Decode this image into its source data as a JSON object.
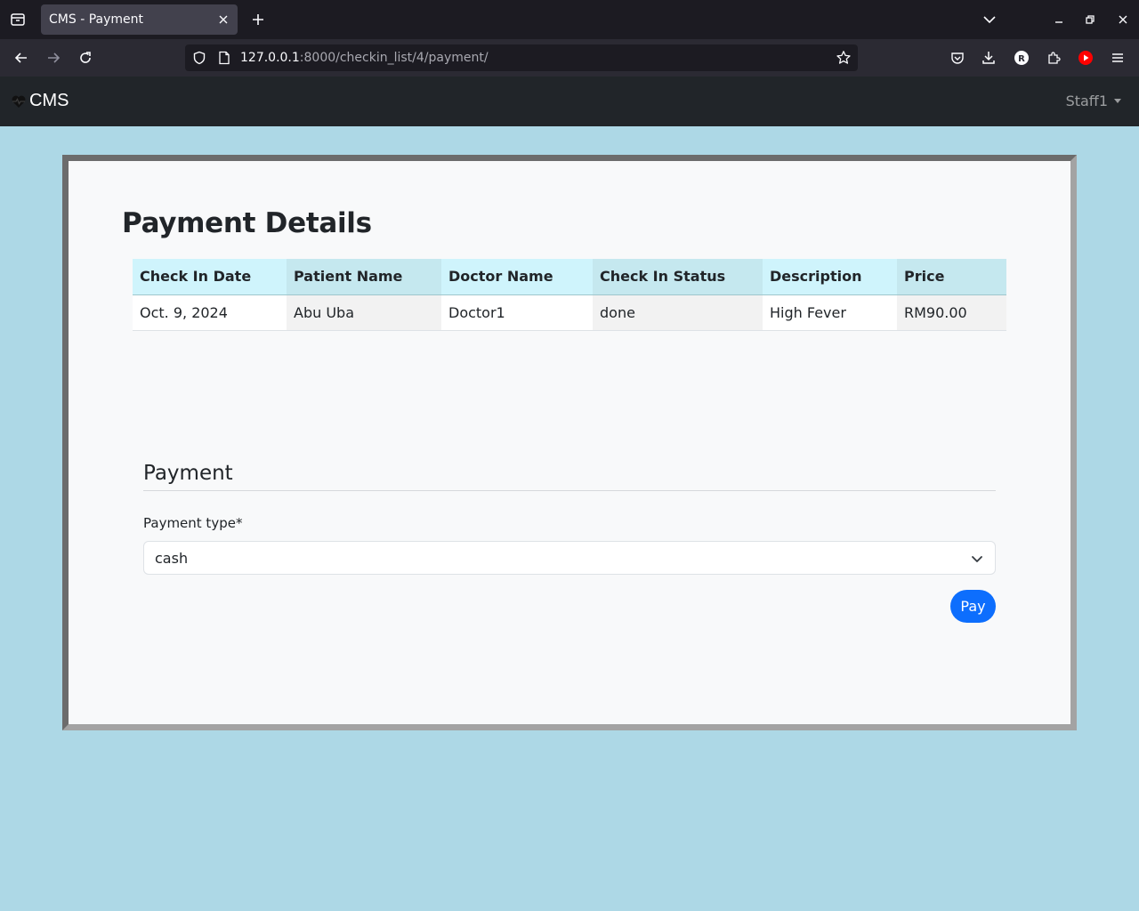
{
  "browser": {
    "tab_title": "CMS - Payment",
    "url_host": "127.0.0.1",
    "url_rest": ":8000/checkin_list/4/payment/"
  },
  "app": {
    "brand": "CMS",
    "user": "Staff1"
  },
  "page": {
    "title": "Payment Details",
    "table": {
      "headers": [
        "Check In Date",
        "Patient Name",
        "Doctor Name",
        "Check In Status",
        "Description",
        "Price"
      ],
      "rows": [
        [
          "Oct. 9, 2024",
          "Abu Uba",
          "Doctor1",
          "done",
          "High Fever",
          "RM90.00"
        ]
      ]
    },
    "payment": {
      "section_title": "Payment",
      "field_label": "Payment type*",
      "selected_value": "cash",
      "submit_label": "Pay"
    }
  },
  "colors": {
    "page_bg": "#add8e6",
    "navbar_bg": "#212529",
    "primary": "#0d6efd",
    "table_header": "#cff4fc"
  }
}
